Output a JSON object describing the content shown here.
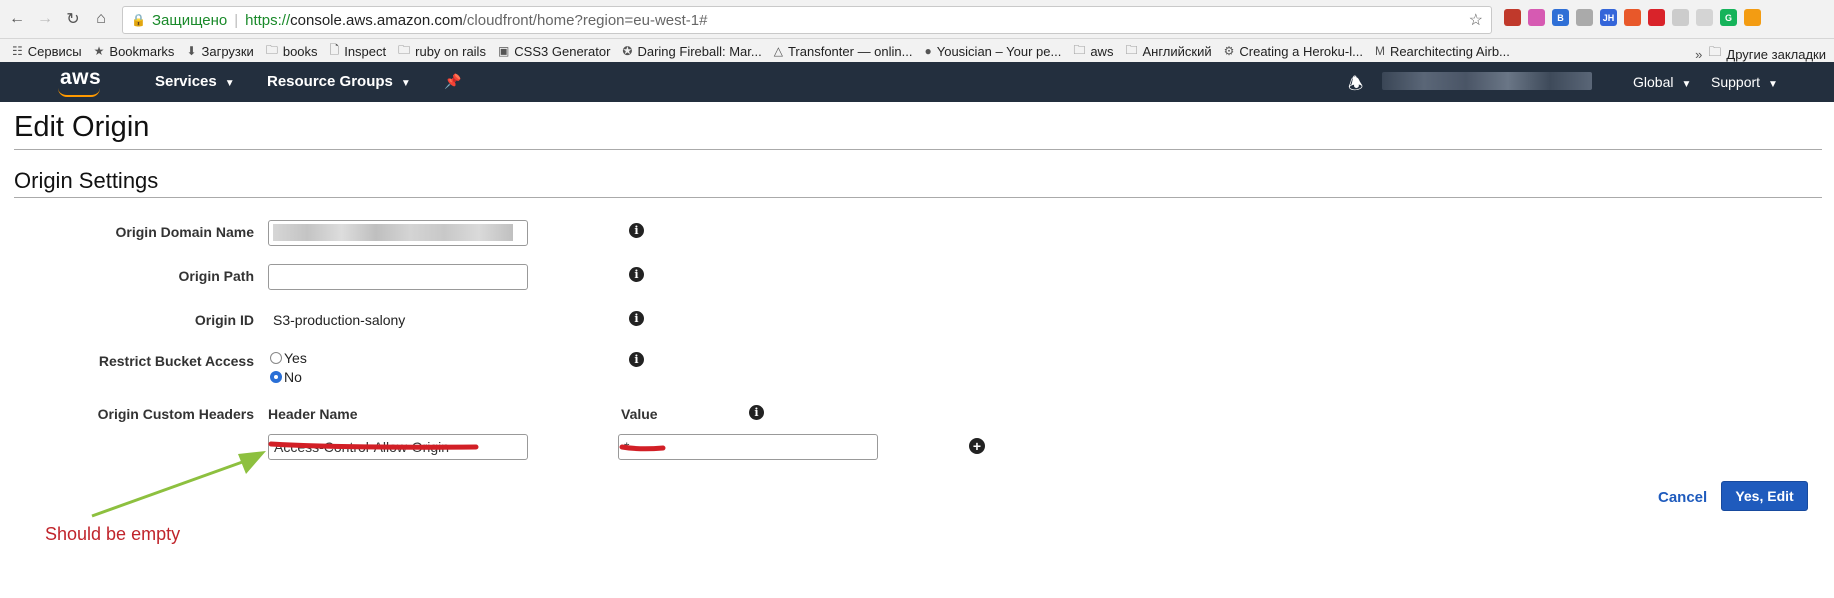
{
  "browser": {
    "secure_label": "Защищено",
    "url_scheme": "https://",
    "url_host": "console.aws.amazon.com",
    "url_path": "/cloudfront/home?region=eu-west-1#",
    "extensions": [
      {
        "text": "",
        "color": "#c0392b"
      },
      {
        "text": "",
        "color": "#d65ab2"
      },
      {
        "text": "B",
        "color": "#2f6fd6"
      },
      {
        "text": "",
        "color": "#aaaaaa"
      },
      {
        "text": "JH",
        "color": "#3465d9"
      },
      {
        "text": "",
        "color": "#e8582a"
      },
      {
        "text": "",
        "color": "#d9232a"
      },
      {
        "text": "",
        "color": "#cccccc"
      },
      {
        "text": "",
        "color": "#d4d4d4"
      },
      {
        "text": "G",
        "color": "#15b35a"
      },
      {
        "text": "",
        "color": "#f39c12"
      }
    ]
  },
  "bookmarks": {
    "items": [
      {
        "label": "Сервисы",
        "icon": "apps-grid-icon"
      },
      {
        "label": "Bookmarks",
        "icon": "star-icon"
      },
      {
        "label": "Загрузки",
        "icon": "download-icon"
      },
      {
        "label": "books",
        "icon": "folder-icon"
      },
      {
        "label": "Inspect",
        "icon": "page-icon"
      },
      {
        "label": "ruby on rails",
        "icon": "folder-icon"
      },
      {
        "label": "CSS3 Generator",
        "icon": "css3-icon"
      },
      {
        "label": "Daring Fireball: Mar...",
        "icon": "star-circle-icon"
      },
      {
        "label": "Transfonter — onlin...",
        "icon": "triangle-icon"
      },
      {
        "label": "Yousician – Your pe...",
        "icon": "yousician-icon"
      },
      {
        "label": "aws",
        "icon": "folder-icon"
      },
      {
        "label": "Английский",
        "icon": "folder-icon"
      },
      {
        "label": "Creating a Heroku-l...",
        "icon": "gear-icon"
      },
      {
        "label": "Rearchitecting Airb...",
        "icon": "medium-icon"
      }
    ],
    "more_label": "Другие закладки"
  },
  "aws_nav": {
    "logo": "aws",
    "services": "Services",
    "resource_groups": "Resource Groups",
    "region": "Global",
    "support": "Support"
  },
  "page": {
    "title": "Edit Origin",
    "section": "Origin Settings"
  },
  "form": {
    "origin_domain_name_label": "Origin Domain Name",
    "origin_path_label": "Origin Path",
    "origin_path_value": "",
    "origin_id_label": "Origin ID",
    "origin_id_value": "S3-production-salony",
    "restrict_bucket_label": "Restrict Bucket Access",
    "restrict_yes": "Yes",
    "restrict_no": "No",
    "restrict_selected": "No",
    "custom_headers_label": "Origin Custom Headers",
    "header_name_col": "Header Name",
    "value_col": "Value",
    "header_name_value": "Access-Control-Allow-Origin",
    "header_value_value": "*"
  },
  "actions": {
    "cancel": "Cancel",
    "submit": "Yes, Edit"
  },
  "annotation": {
    "text": "Should be empty",
    "arrow_color": "#8dc03f",
    "strike_color": "#d21f26"
  }
}
